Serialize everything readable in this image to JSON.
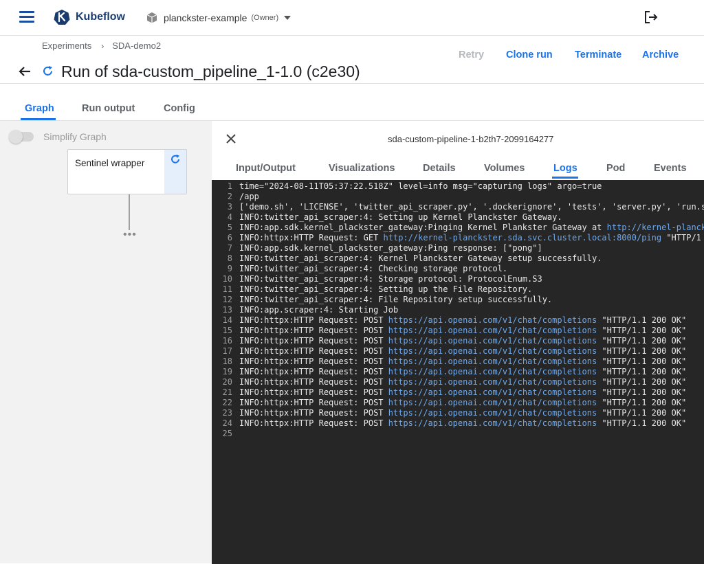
{
  "header": {
    "brand": "Kubeflow",
    "namespace": "planckster-example",
    "namespace_role": "(Owner)"
  },
  "breadcrumb": {
    "items": [
      "Experiments",
      "SDA-demo2"
    ],
    "separator": "›"
  },
  "run": {
    "title": "Run of sda-custom_pipeline_1-1.0 (c2e30)"
  },
  "actions": {
    "retry": "Retry",
    "clone": "Clone run",
    "terminate": "Terminate",
    "archive": "Archive"
  },
  "tabs": {
    "graph": "Graph",
    "run_output": "Run output",
    "config": "Config",
    "active": "Graph"
  },
  "graph": {
    "simplify_label": "Simplify Graph",
    "node_label": "Sentinel wrapper",
    "more": "•••"
  },
  "panel": {
    "pod_name": "sda-custom-pipeline-1-b2th7-2099164277",
    "tabs": [
      "Input/Output",
      "Visualizations",
      "Details",
      "Volumes",
      "Logs",
      "Pod",
      "Events"
    ],
    "active_tab": "Logs"
  },
  "logs": [
    {
      "n": "1",
      "pre": "time=\"2024-08-11T05:37:22.518Z\" level=info msg=\"capturing logs\" argo=true",
      "link": "",
      "post": ""
    },
    {
      "n": "2",
      "pre": "/app",
      "link": "",
      "post": ""
    },
    {
      "n": "3",
      "pre": "['demo.sh', 'LICENSE', 'twitter_api_scraper.py', '.dockerignore', 'tests', 'server.py', 'run.s",
      "link": "",
      "post": ""
    },
    {
      "n": "4",
      "pre": "INFO:twitter_api_scraper:4: Setting up Kernel Planckster Gateway.",
      "link": "",
      "post": ""
    },
    {
      "n": "5",
      "pre": "INFO:app.sdk.kernel_plackster_gateway:Pinging Kernel Plankster Gateway at ",
      "link": "http://kernel-planck",
      "post": ""
    },
    {
      "n": "6",
      "pre": "INFO:httpx:HTTP Request: GET ",
      "link": "http://kernel-planckster.sda.svc.cluster.local:8000/ping",
      "post": " \"HTTP/1"
    },
    {
      "n": "7",
      "pre": "INFO:app.sdk.kernel_plackster_gateway:Ping response: [\"pong\"]",
      "link": "",
      "post": ""
    },
    {
      "n": "8",
      "pre": "INFO:twitter_api_scraper:4: Kernel Planckster Gateway setup successfully.",
      "link": "",
      "post": ""
    },
    {
      "n": "9",
      "pre": "INFO:twitter_api_scraper:4: Checking storage protocol.",
      "link": "",
      "post": ""
    },
    {
      "n": "10",
      "pre": "INFO:twitter_api_scraper:4: Storage protocol: ProtocolEnum.S3",
      "link": "",
      "post": ""
    },
    {
      "n": "11",
      "pre": "INFO:twitter_api_scraper:4: Setting up the File Repository.",
      "link": "",
      "post": ""
    },
    {
      "n": "12",
      "pre": "INFO:twitter_api_scraper:4: File Repository setup successfully.",
      "link": "",
      "post": ""
    },
    {
      "n": "13",
      "pre": "INFO:app.scraper:4: Starting Job",
      "link": "",
      "post": ""
    },
    {
      "n": "14",
      "pre": "INFO:httpx:HTTP Request: POST ",
      "link": "https://api.openai.com/v1/chat/completions",
      "post": " \"HTTP/1.1 200 OK\""
    },
    {
      "n": "15",
      "pre": "INFO:httpx:HTTP Request: POST ",
      "link": "https://api.openai.com/v1/chat/completions",
      "post": " \"HTTP/1.1 200 OK\""
    },
    {
      "n": "16",
      "pre": "INFO:httpx:HTTP Request: POST ",
      "link": "https://api.openai.com/v1/chat/completions",
      "post": " \"HTTP/1.1 200 OK\""
    },
    {
      "n": "17",
      "pre": "INFO:httpx:HTTP Request: POST ",
      "link": "https://api.openai.com/v1/chat/completions",
      "post": " \"HTTP/1.1 200 OK\""
    },
    {
      "n": "18",
      "pre": "INFO:httpx:HTTP Request: POST ",
      "link": "https://api.openai.com/v1/chat/completions",
      "post": " \"HTTP/1.1 200 OK\""
    },
    {
      "n": "19",
      "pre": "INFO:httpx:HTTP Request: POST ",
      "link": "https://api.openai.com/v1/chat/completions",
      "post": " \"HTTP/1.1 200 OK\""
    },
    {
      "n": "20",
      "pre": "INFO:httpx:HTTP Request: POST ",
      "link": "https://api.openai.com/v1/chat/completions",
      "post": " \"HTTP/1.1 200 OK\""
    },
    {
      "n": "21",
      "pre": "INFO:httpx:HTTP Request: POST ",
      "link": "https://api.openai.com/v1/chat/completions",
      "post": " \"HTTP/1.1 200 OK\""
    },
    {
      "n": "22",
      "pre": "INFO:httpx:HTTP Request: POST ",
      "link": "https://api.openai.com/v1/chat/completions",
      "post": " \"HTTP/1.1 200 OK\""
    },
    {
      "n": "23",
      "pre": "INFO:httpx:HTTP Request: POST ",
      "link": "https://api.openai.com/v1/chat/completions",
      "post": " \"HTTP/1.1 200 OK\""
    },
    {
      "n": "24",
      "pre": "INFO:httpx:HTTP Request: POST ",
      "link": "https://api.openai.com/v1/chat/completions",
      "post": " \"HTTP/1.1 200 OK\""
    },
    {
      "n": "25",
      "pre": "",
      "link": "",
      "post": ""
    }
  ],
  "icons": {
    "menu": "hamburger-icon",
    "logo": "kubeflow-logo-icon",
    "namespace": "cube-icon",
    "logout": "logout-icon",
    "back": "arrow-left-icon",
    "run_status": "refresh-icon",
    "close": "close-icon"
  },
  "colors": {
    "accent": "#1a73e8",
    "brand": "#1a3b6e",
    "log_background": "#262626",
    "log_link": "#6ea8ea",
    "disabled": "#b5b8bc"
  }
}
